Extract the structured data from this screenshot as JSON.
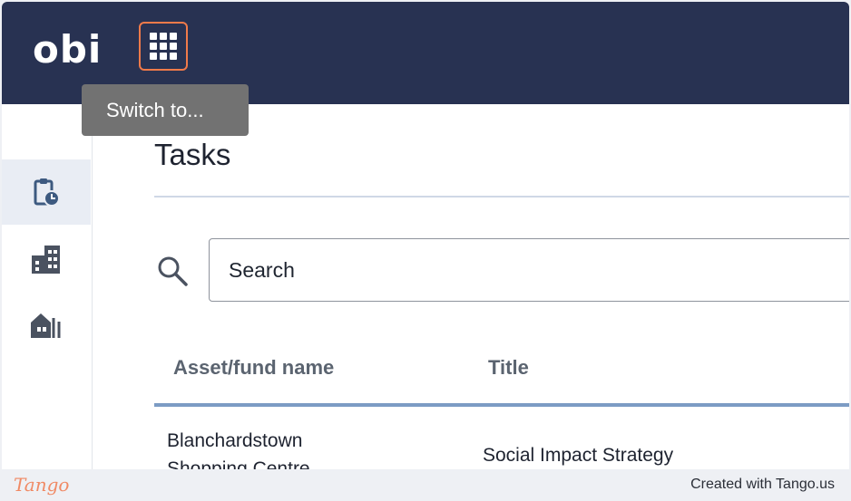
{
  "brand": {
    "logo_text": "obi"
  },
  "topbar": {
    "apps_icon": "grid-icon",
    "tooltip": "Switch to...",
    "accent_color": "#f07a4a",
    "bar_color": "#283252"
  },
  "sidebar": {
    "items": [
      {
        "icon": "clipboard-clock-icon",
        "active": true
      },
      {
        "icon": "buildings-icon",
        "active": false
      },
      {
        "icon": "houses-icon",
        "active": false
      }
    ]
  },
  "main": {
    "title": "Tasks",
    "search": {
      "placeholder": "Search",
      "icon": "search-icon"
    },
    "table": {
      "columns": [
        "Asset/fund name",
        "Title"
      ],
      "rows": [
        {
          "asset": "Blanchardstown Shopping Centre",
          "title": "Social Impact Strategy"
        }
      ]
    }
  },
  "footer": {
    "logo_text": "Tango",
    "credit": "Created with Tango.us"
  }
}
